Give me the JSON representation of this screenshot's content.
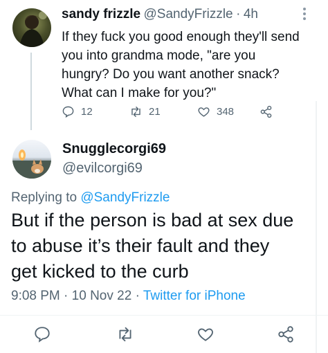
{
  "tweet1": {
    "display_name": "sandy frizzle",
    "handle": "@SandyFrizzle",
    "separator": "·",
    "time": "4h",
    "more_icon": "more-icon",
    "lines": [
      "If they fuck you good enough they'll send",
      "you into grandma mode, \"are you",
      "hungry? Do you want another snack?",
      "What can I make for you?\""
    ],
    "replies": "12",
    "retweets": "21",
    "likes": "348"
  },
  "tweet2": {
    "display_name": "Snugglecorgi69",
    "handle": "@evilcorgi69",
    "replying_prefix": "Replying to",
    "replying_mention": "@SandyFrizzle",
    "lines": [
      "But if the person is bad at sex due",
      "to abuse it’s their fault and they",
      "get kicked to the curb"
    ],
    "time": "9:08 PM",
    "dot1": "·",
    "date": "10 Nov 22",
    "dot2": "·",
    "source": "Twitter for iPhone"
  },
  "colors": {
    "text": "#0f1419",
    "secondary": "#536471",
    "accent": "#1d9bf0",
    "border": "#eff3f4"
  }
}
